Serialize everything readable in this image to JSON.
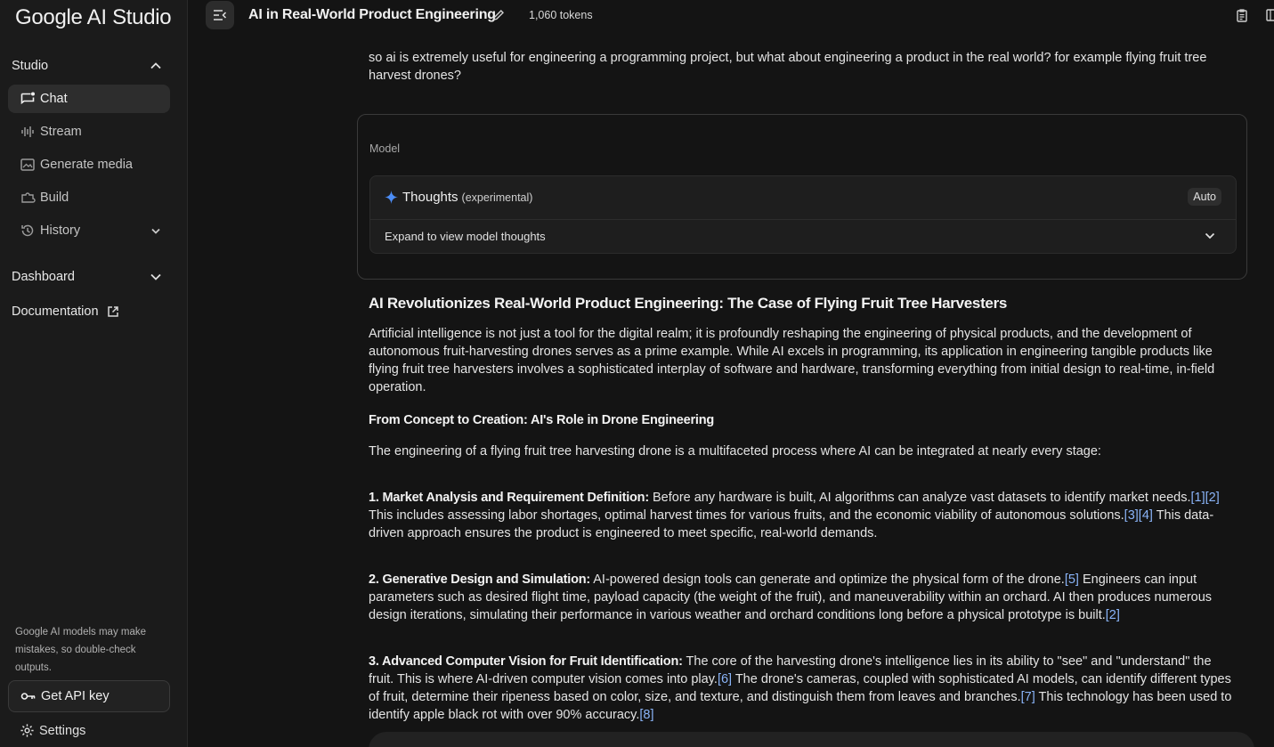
{
  "sidebar": {
    "logo": "Google AI Studio",
    "studio_label": "Studio",
    "items": [
      {
        "label": "Chat"
      },
      {
        "label": "Stream"
      },
      {
        "label": "Generate media"
      },
      {
        "label": "Build"
      },
      {
        "label": "History"
      }
    ],
    "dashboard_label": "Dashboard",
    "documentation_label": "Documentation",
    "disclaimer": "Google AI models may make mistakes, so double-check outputs.",
    "api_key_label": "Get API key",
    "settings_label": "Settings"
  },
  "header": {
    "title": "AI in Real-World Product Engineering",
    "tokens": "1,060 tokens"
  },
  "chat": {
    "user_message": "so ai is extremely useful for engineering a programming project, but what about engineering a product in the real world? for example flying fruit tree harvest drones?",
    "model_label": "Model",
    "thoughts_title": "Thoughts",
    "thoughts_tag": "(experimental)",
    "thoughts_mode": "Auto",
    "thoughts_expand": "Expand to view model thoughts",
    "heading": "AI Revolutionizes Real-World Product Engineering: The Case of Flying Fruit Tree Harvesters",
    "intro": "Artificial intelligence is not just a tool for the digital realm; it is profoundly reshaping the engineering of physical products, and the development of autonomous fruit-harvesting drones serves as a prime example. While AI excels in programming, its application in engineering tangible products like flying fruit tree harvesters involves a sophisticated interplay of software and hardware, transforming everything from initial design to real-time, in-field operation.",
    "subheading": "From Concept to Creation: AI's Role in Drone Engineering",
    "lead": "The engineering of a flying fruit tree harvesting drone is a multifaceted process where AI can be integrated at nearly every stage:",
    "points": [
      {
        "title": "1. Market Analysis and Requirement Definition:",
        "s1": " Before any hardware is built, AI algorithms can analyze vast datasets to identify market needs.",
        "c1": "[1]",
        "c2": "[2]",
        "s2": " This includes assessing labor shortages, optimal harvest times for various fruits, and the economic viability of autonomous solutions.",
        "c3": "[3]",
        "c4": "[4]",
        "s3": " This data-driven approach ensures the product is engineered to meet specific, real-world demands."
      },
      {
        "title": "2. Generative Design and Simulation:",
        "s1": " AI-powered design tools can generate and optimize the physical form of the drone.",
        "c1": "[5]",
        "s2": " Engineers can input parameters such as desired flight time, payload capacity (the weight of the fruit), and maneuverability within an orchard. AI then produces numerous design iterations, simulating their performance in various weather and orchard conditions long before a physical prototype is built.",
        "c2": "[2]"
      },
      {
        "title": "3. Advanced Computer Vision for Fruit Identification:",
        "s1": " The core of the harvesting drone's intelligence lies in its ability to \"see\" and \"understand\" the fruit. This is where AI-driven computer vision comes into play.",
        "c1": "[6]",
        "s2": " The drone's cameras, coupled with sophisticated AI models, can identify different types of fruit, determine their ripeness based on color, size, and texture, and distinguish them from leaves and branches.",
        "c2": "[7]",
        "s3": " This technology has been used to identify apple black rot with over 90% accuracy.",
        "c3": "[8]"
      }
    ]
  },
  "colors": {
    "accent": "#8ab4f8",
    "sparkle": "#4c8df6",
    "background": "#141414",
    "sidebar": "#1b1b1b"
  },
  "icons": [
    "chat-icon",
    "stream-icon",
    "generate-media-icon",
    "build-icon",
    "history-icon",
    "external-link-icon",
    "key-icon",
    "gear-icon",
    "sidebar-toggle-icon",
    "pencil-icon",
    "sparkle-icon",
    "chevron-down-icon",
    "chevron-up-icon"
  ]
}
